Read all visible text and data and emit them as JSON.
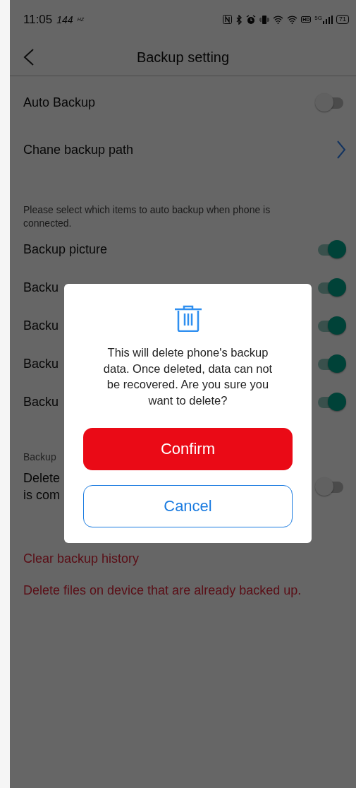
{
  "status_bar": {
    "time": "11:05",
    "refresh_rate": "144",
    "refresh_unit": "HZ",
    "hd": "HD",
    "network": "5G",
    "battery": "71"
  },
  "header": {
    "title": "Backup setting"
  },
  "settings": [
    {
      "kind": "toggle",
      "label": "Auto Backup",
      "on": false
    },
    {
      "kind": "link",
      "label": "Chane backup path"
    }
  ],
  "auto_backup_note": "Please select which items to auto backup when phone is connected.",
  "backup_items": [
    {
      "label": "Backup picture",
      "on": true
    },
    {
      "label": "Backu",
      "on": true
    },
    {
      "label": "Backu",
      "on": true
    },
    {
      "label": "Backu",
      "on": true
    },
    {
      "label": "Backu",
      "on": true
    }
  ],
  "section": {
    "title": "Backup",
    "item": {
      "lines": [
        "Delete",
        "is com"
      ],
      "on": false
    }
  },
  "actions": [
    {
      "label": "Clear backup history"
    },
    {
      "label": "Delete files on device that are already backed up."
    }
  ],
  "dialog": {
    "message": "This will delete phone's backup data. Once deleted, data can not be recovered. Are you sure you want to delete?",
    "buttons": [
      {
        "kind": "primary",
        "label": "Confirm"
      },
      {
        "kind": "secondary",
        "label": "Cancel"
      }
    ]
  }
}
